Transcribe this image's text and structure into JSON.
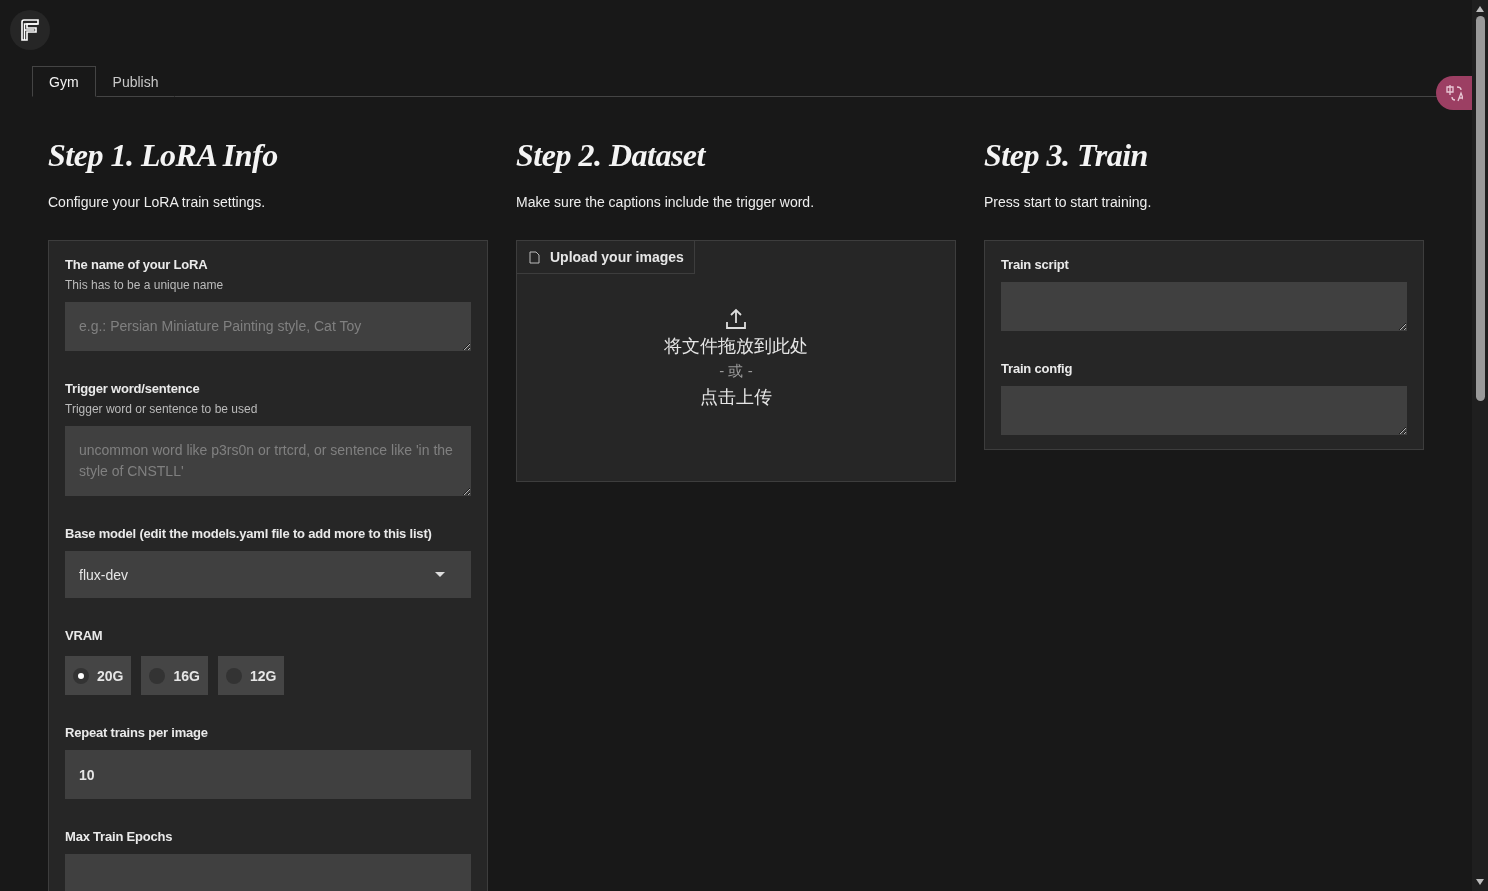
{
  "tabs": [
    {
      "label": "Gym",
      "selected": true
    },
    {
      "label": "Publish",
      "selected": false
    }
  ],
  "columns": [
    {
      "kind": "form",
      "title": "Step 1. LoRA Info",
      "subtitle": "Configure your LoRA train settings.",
      "fields": [
        {
          "kind": "textarea",
          "label": "The name of your LoRA",
          "info": "This has to be a unique name",
          "placeholder": "e.g.: Persian Miniature Painting style, Cat Toy"
        },
        {
          "kind": "textarea",
          "label": "Trigger word/sentence",
          "info": "Trigger word or sentence to be used",
          "placeholder": "uncommon word like p3rs0n or trtcrd, or sentence like 'in the style of CNSTLL'"
        },
        {
          "kind": "dropdown",
          "label": "Base model (edit the models.yaml file to add more to this list)",
          "value": "flux-dev"
        },
        {
          "kind": "radio",
          "label": "VRAM",
          "options": [
            {
              "label": "20G",
              "selected": true
            },
            {
              "label": "16G",
              "selected": false
            },
            {
              "label": "12G",
              "selected": false
            }
          ]
        },
        {
          "kind": "number",
          "label": "Repeat trains per image",
          "value": "10"
        },
        {
          "kind": "number",
          "label": "Max Train Epochs"
        }
      ]
    },
    {
      "kind": "upload",
      "title": "Step 2. Dataset",
      "subtitle": "Make sure the captions include the trigger word.",
      "upload": {
        "label": "Upload your images",
        "drop_text": "将文件拖放到此处",
        "or_text": "- 或 -",
        "click_text": "点击上传"
      }
    },
    {
      "kind": "form",
      "title": "Step 3. Train",
      "subtitle": "Press start to start training.",
      "fields": [
        {
          "kind": "textarea",
          "label": "Train script"
        },
        {
          "kind": "textarea",
          "label": "Train config"
        }
      ]
    }
  ]
}
